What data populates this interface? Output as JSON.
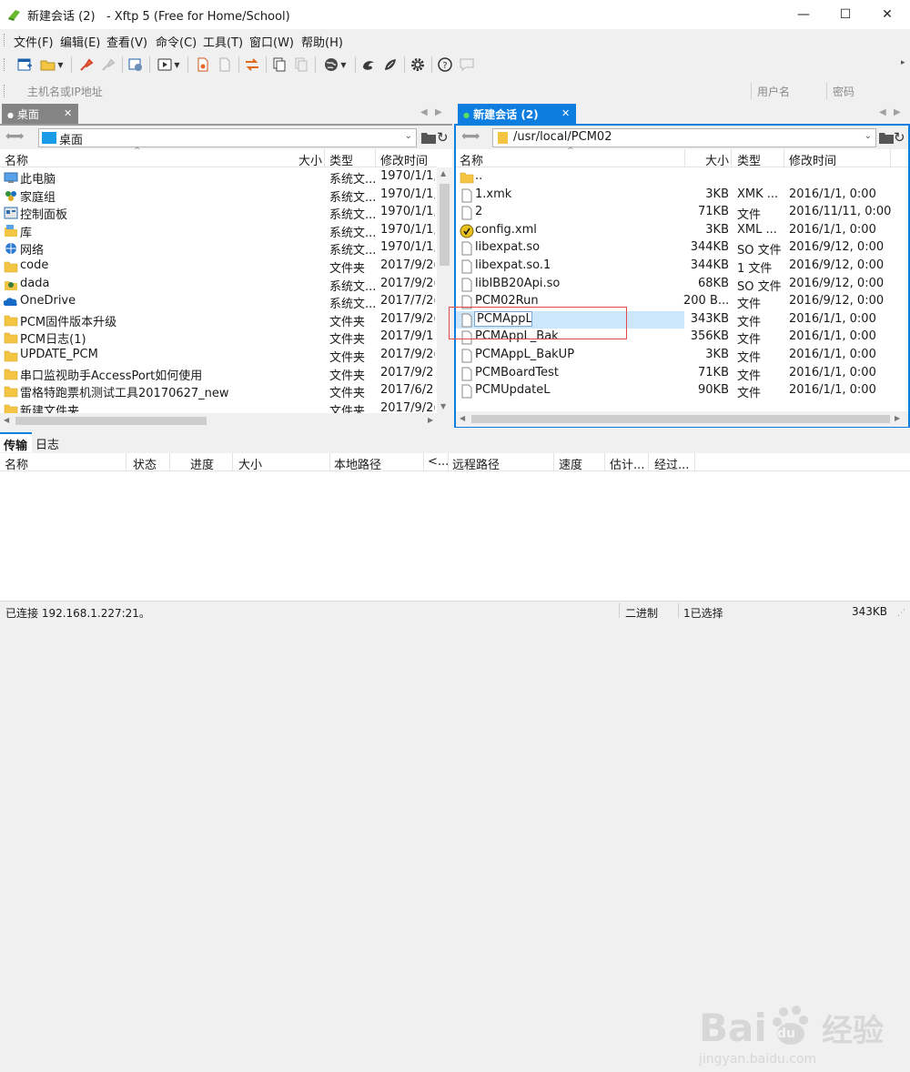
{
  "window": {
    "title": "新建会话 (2)   - Xftp 5 (Free for Home/School)",
    "minimize": "—",
    "maximize": "☐",
    "close": "✕"
  },
  "menu": [
    "文件(F)",
    "编辑(E)",
    "查看(V)",
    "命令(C)",
    "工具(T)",
    "窗口(W)",
    "帮助(H)"
  ],
  "address": {
    "host_placeholder": "主机名或IP地址",
    "user_placeholder": "用户名",
    "password_placeholder": "密码"
  },
  "left_pane": {
    "tab_label": "桌面",
    "path": "桌面",
    "columns": [
      "名称",
      "大小",
      "类型",
      "修改时间"
    ],
    "rows": [
      {
        "name": "此电脑",
        "size": "",
        "type": "系统文...",
        "modified": "1970/1/1,",
        "icon": "computer-icon"
      },
      {
        "name": "家庭组",
        "size": "",
        "type": "系统文...",
        "modified": "1970/1/1,",
        "icon": "homegroup-icon"
      },
      {
        "name": "控制面板",
        "size": "",
        "type": "系统文...",
        "modified": "1970/1/1,",
        "icon": "control-panel-icon"
      },
      {
        "name": "库",
        "size": "",
        "type": "系统文...",
        "modified": "1970/1/1,",
        "icon": "library-icon"
      },
      {
        "name": "网络",
        "size": "",
        "type": "系统文...",
        "modified": "1970/1/1,",
        "icon": "network-icon"
      },
      {
        "name": "code",
        "size": "",
        "type": "文件夹",
        "modified": "2017/9/2(",
        "icon": "folder-icon"
      },
      {
        "name": "dada",
        "size": "",
        "type": "系统文...",
        "modified": "2017/9/2(",
        "icon": "user-icon"
      },
      {
        "name": "OneDrive",
        "size": "",
        "type": "系统文...",
        "modified": "2017/7/2(",
        "icon": "onedrive-icon"
      },
      {
        "name": "PCM固件版本升级",
        "size": "",
        "type": "文件夹",
        "modified": "2017/9/2(",
        "icon": "folder-icon"
      },
      {
        "name": "PCM日志(1)",
        "size": "",
        "type": "文件夹",
        "modified": "2017/9/1{",
        "icon": "folder-icon"
      },
      {
        "name": "UPDATE_PCM",
        "size": "",
        "type": "文件夹",
        "modified": "2017/9/2(",
        "icon": "folder-icon"
      },
      {
        "name": "串口监视助手AccessPort如何使用",
        "size": "",
        "type": "文件夹",
        "modified": "2017/9/2{",
        "icon": "folder-icon"
      },
      {
        "name": "雷格特跑票机测试工具20170627_new",
        "size": "",
        "type": "文件夹",
        "modified": "2017/6/2{",
        "icon": "folder-icon"
      },
      {
        "name": "新建文件夹",
        "size": "",
        "type": "文件夹",
        "modified": "2017/9/2(",
        "icon": "folder-icon"
      }
    ]
  },
  "right_pane": {
    "tab_label": "新建会话 (2)",
    "path": "/usr/local/PCM02",
    "columns": [
      "名称",
      "大小",
      "类型",
      "修改时间"
    ],
    "rows": [
      {
        "name": "..",
        "size": "",
        "type": "",
        "modified": "",
        "icon": "folder-icon"
      },
      {
        "name": "1.xmk",
        "size": "3KB",
        "type": "XMK ...",
        "modified": "2016/1/1, 0:00",
        "icon": "file-icon"
      },
      {
        "name": "2",
        "size": "71KB",
        "type": "文件",
        "modified": "2016/11/11, 0:00",
        "icon": "file-icon"
      },
      {
        "name": "config.xml",
        "size": "3KB",
        "type": "XML ...",
        "modified": "2016/1/1, 0:00",
        "icon": "xml-file-icon"
      },
      {
        "name": "libexpat.so",
        "size": "344KB",
        "type": "SO 文件",
        "modified": "2016/9/12, 0:00",
        "icon": "file-icon"
      },
      {
        "name": "libexpat.so.1",
        "size": "344KB",
        "type": "1 文件",
        "modified": "2016/9/12, 0:00",
        "icon": "file-icon"
      },
      {
        "name": "libIBB20Api.so",
        "size": "68KB",
        "type": "SO 文件",
        "modified": "2016/9/12, 0:00",
        "icon": "file-icon"
      },
      {
        "name": "PCM02Run",
        "size": "200 B...",
        "type": "文件",
        "modified": "2016/9/12, 0:00",
        "icon": "file-icon"
      },
      {
        "name": "PCMAppL",
        "size": "343KB",
        "type": "文件",
        "modified": "2016/1/1, 0:00",
        "icon": "file-icon",
        "selected": true
      },
      {
        "name": "PCMAppL_Bak",
        "size": "356KB",
        "type": "文件",
        "modified": "2016/1/1, 0:00",
        "icon": "file-icon"
      },
      {
        "name": "PCMAppL_BakUP",
        "size": "3KB",
        "type": "文件",
        "modified": "2016/1/1, 0:00",
        "icon": "file-icon"
      },
      {
        "name": "PCMBoardTest",
        "size": "71KB",
        "type": "文件",
        "modified": "2016/1/1, 0:00",
        "icon": "file-icon"
      },
      {
        "name": "PCMUpdateL",
        "size": "90KB",
        "type": "文件",
        "modified": "2016/1/1, 0:00",
        "icon": "file-icon"
      }
    ]
  },
  "bottom": {
    "tabs": [
      "传输",
      "日志"
    ],
    "columns": [
      "名称",
      "状态",
      "进度",
      "大小",
      "本地路径",
      "<...",
      "远程路径",
      "速度",
      "估计...",
      "经过..."
    ]
  },
  "status": {
    "connection": "已连接 192.168.1.227:21。",
    "mode": "二进制",
    "selection": "1已选择",
    "size": "343KB"
  },
  "watermark": {
    "brand": "Bai",
    "brand2": "du",
    "cn": "经验",
    "url": "jingyan.baidu.com"
  },
  "colors": {
    "accent": "#0a7ad6",
    "tab_active": "#0d7ee0",
    "tab_inactive": "#848484",
    "selection": "#cce6fb",
    "highlight_box": "#e24a4a",
    "folder": "#f4c542"
  }
}
